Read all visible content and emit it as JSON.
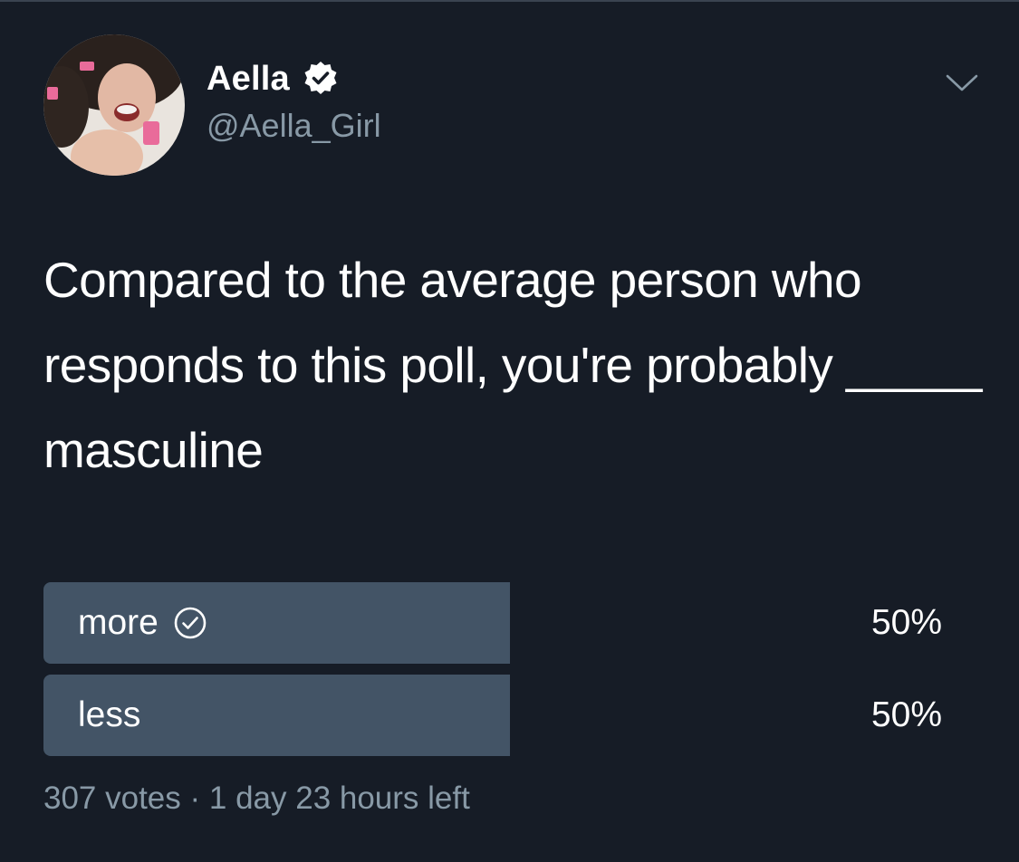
{
  "tweet": {
    "display_name": "Aella",
    "handle": "@Aella_Girl",
    "verified": true,
    "text": "Compared to the average person who responds to this poll, you're probably _____ masculine"
  },
  "poll": {
    "options": [
      {
        "label": "more",
        "percent": "50%",
        "fraction": 0.5,
        "selected": true
      },
      {
        "label": "less",
        "percent": "50%",
        "fraction": 0.5,
        "selected": false
      }
    ],
    "meta": "307 votes · 1 day 23 hours left"
  },
  "icons": {
    "verified": "verified-badge-icon",
    "menu": "chevron-down-icon",
    "selected": "check-circle-icon"
  },
  "colors": {
    "background": "#161c26",
    "poll_bar": "#435466",
    "secondary_text": "#8899a6",
    "primary_text": "#ffffff"
  }
}
